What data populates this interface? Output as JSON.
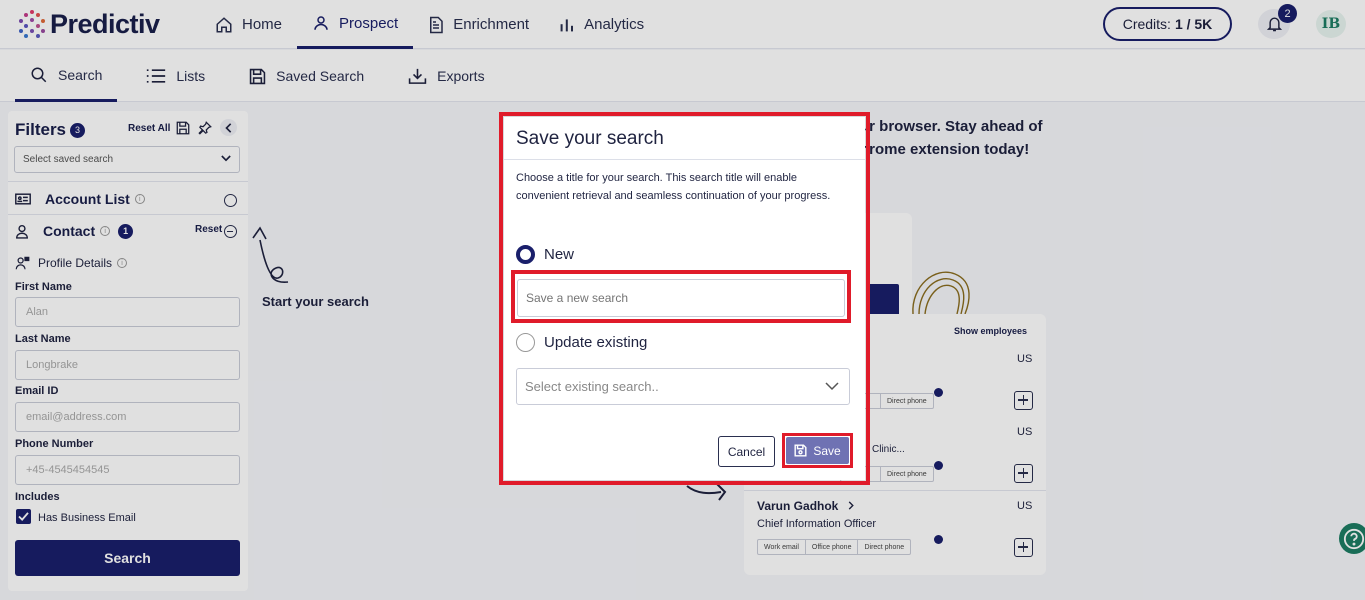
{
  "app": {
    "brand": "Predictiv"
  },
  "topnav": {
    "items": [
      {
        "label": "Home",
        "icon": "home-icon"
      },
      {
        "label": "Prospect",
        "icon": "user-icon"
      },
      {
        "label": "Enrichment",
        "icon": "document-icon"
      },
      {
        "label": "Analytics",
        "icon": "bar-chart-icon"
      }
    ],
    "credits_label": "Credits:",
    "credits_value": "1 / 5K",
    "notifications_count": "2",
    "avatar_initials": "IB"
  },
  "subnav": {
    "items": [
      {
        "label": "Search",
        "icon": "search-icon"
      },
      {
        "label": "Lists",
        "icon": "list-icon"
      },
      {
        "label": "Saved Search",
        "icon": "save-icon"
      },
      {
        "label": "Exports",
        "icon": "download-icon"
      }
    ]
  },
  "filters": {
    "title": "Filters",
    "count": "3",
    "reset_all": "Reset All",
    "saved_search_placeholder": "Select saved search",
    "account_list": "Account List",
    "contact": "Contact",
    "contact_count": "1",
    "contact_reset": "Reset",
    "profile_details": "Profile Details",
    "fields": [
      {
        "label": "First Name",
        "placeholder": "Alan"
      },
      {
        "label": "Last Name",
        "placeholder": "Longbrake"
      },
      {
        "label": "Email ID",
        "placeholder": "email@address.com"
      },
      {
        "label": "Phone Number",
        "placeholder": "+45-4545454545"
      }
    ],
    "includes": "Includes",
    "has_business_email": "Has Business Email",
    "search_button": "Search"
  },
  "main": {
    "start_search": "Start your search",
    "promo_line1": "ur browser. Stay ahead of",
    "promo_line2": "hrome extension today!",
    "show_employees": "Show employees",
    "country": "US",
    "chip_work_email": "Work email",
    "chip_office_phone": "Office phone",
    "chip_direct_phone": "Direct phone",
    "clinic_text": "Clinic...",
    "person_name": "Varun Gadhok",
    "person_title": "Chief Information Officer"
  },
  "modal": {
    "title": "Save your search",
    "description": "Choose a title for your search. This search title will enable convenient retrieval and seamless continuation of your progress.",
    "option_new": "New",
    "new_placeholder": "Save a new search",
    "option_update": "Update existing",
    "existing_placeholder": "Select existing search..",
    "cancel": "Cancel",
    "save": "Save"
  },
  "colors": {
    "primary": "#1a1f6b",
    "highlight": "#e01b2a",
    "save_button": "#6f72b3",
    "help": "#1d7d63"
  }
}
